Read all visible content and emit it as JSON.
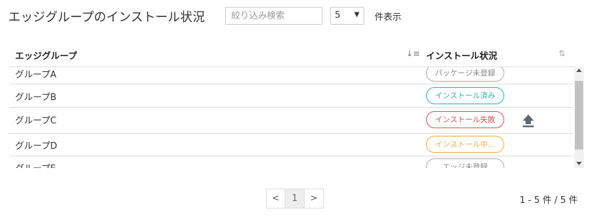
{
  "header": {
    "title": "エッジグループのインストール状況",
    "search_placeholder": "絞り込み検索",
    "page_size": "5",
    "page_size_suffix": "件表示"
  },
  "table": {
    "columns": [
      "エッジグループ",
      "インストール状況"
    ],
    "rows": [
      {
        "name": "グループA",
        "status": "パッケージ未登録",
        "status_color": "#999999"
      },
      {
        "name": "グループB",
        "status": "インストール済み",
        "status_color": "#26b5a5"
      },
      {
        "name": "グループC",
        "status": "インストール失敗",
        "status_color": "#e04b4b"
      },
      {
        "name": "グループD",
        "status": "インストール中…",
        "status_color": "#f2a93b"
      },
      {
        "name": "グループE",
        "status": "エッジ未登録",
        "status_color": "#999999"
      }
    ]
  },
  "pagination": {
    "prev": "<",
    "current": "1",
    "next": ">",
    "summary": "1 - 5 件 / 5 件"
  }
}
